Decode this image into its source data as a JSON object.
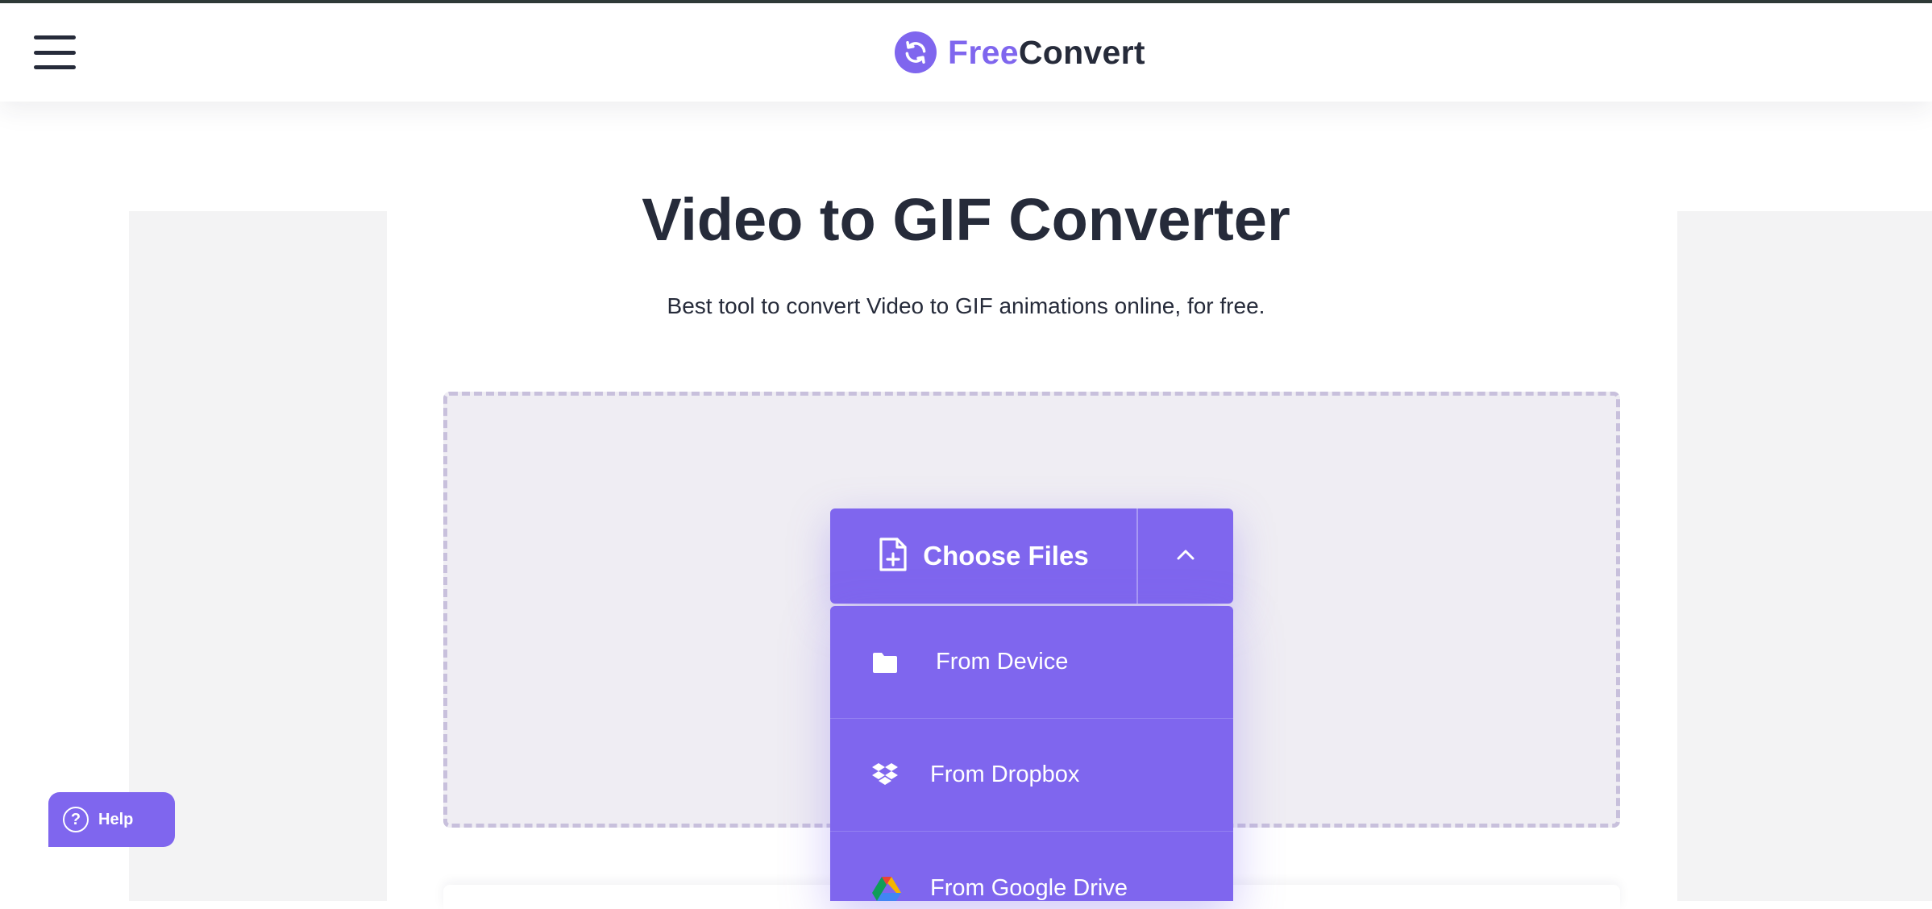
{
  "brand": {
    "name_part1": "Free",
    "name_part2": "Convert",
    "accent_color": "#7f66ee",
    "text_color": "#262b3a",
    "logo_icon": "sync-arrows-icon"
  },
  "header": {
    "menu_icon": "hamburger-menu-icon"
  },
  "main": {
    "title": "Video to GIF Converter",
    "subtitle": "Best tool to convert Video to GIF animations online, for free."
  },
  "upload": {
    "choose_label": "Choose Files",
    "choose_icon": "file-plus-icon",
    "toggle_icon": "chevron-up-icon",
    "sources": [
      {
        "label": "From Device",
        "icon": "folder-icon"
      },
      {
        "label": "From Dropbox",
        "icon": "dropbox-icon"
      },
      {
        "label": "From Google Drive",
        "icon": "google-drive-icon"
      }
    ]
  },
  "help": {
    "label": "Help",
    "icon": "question-circle-icon"
  }
}
